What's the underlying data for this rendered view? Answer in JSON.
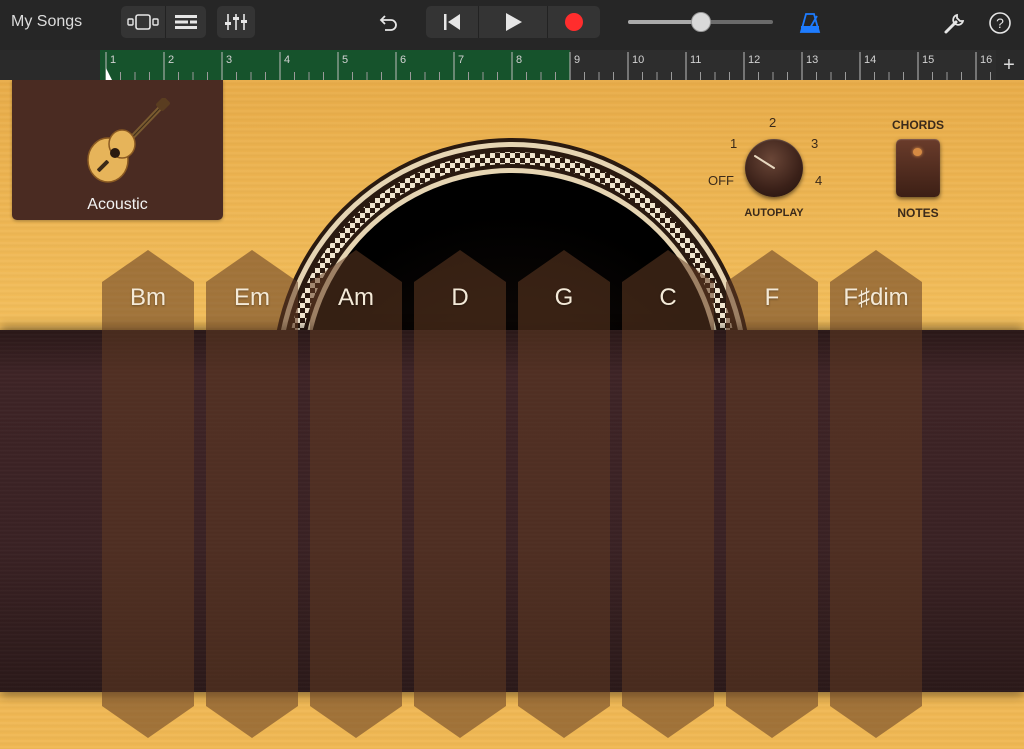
{
  "toolbar": {
    "title": "My Songs",
    "volume_level": 0.5
  },
  "ruler": {
    "bars": [
      "1",
      "2",
      "3",
      "4",
      "5",
      "6",
      "7",
      "8",
      "9",
      "10",
      "11",
      "12",
      "13",
      "14",
      "15",
      "16"
    ],
    "region_end_bar": 9,
    "add_label": "+"
  },
  "instrument": {
    "name": "Acoustic"
  },
  "autoplay": {
    "label": "AUTOPLAY",
    "positions": [
      "OFF",
      "1",
      "2",
      "3",
      "4"
    ],
    "selected": "1"
  },
  "mode_switch": {
    "top_label": "CHORDS",
    "bottom_label": "NOTES",
    "selected": "CHORDS"
  },
  "chords": [
    {
      "label": "Bm"
    },
    {
      "label": "Em"
    },
    {
      "label": "Am"
    },
    {
      "label": "D"
    },
    {
      "label": "G"
    },
    {
      "label": "C"
    },
    {
      "label": "F"
    },
    {
      "label": "F♯dim"
    }
  ],
  "colors": {
    "record": "#ff2d2d",
    "metronome": "#1e7cff",
    "ruler_region": "#16532c"
  }
}
